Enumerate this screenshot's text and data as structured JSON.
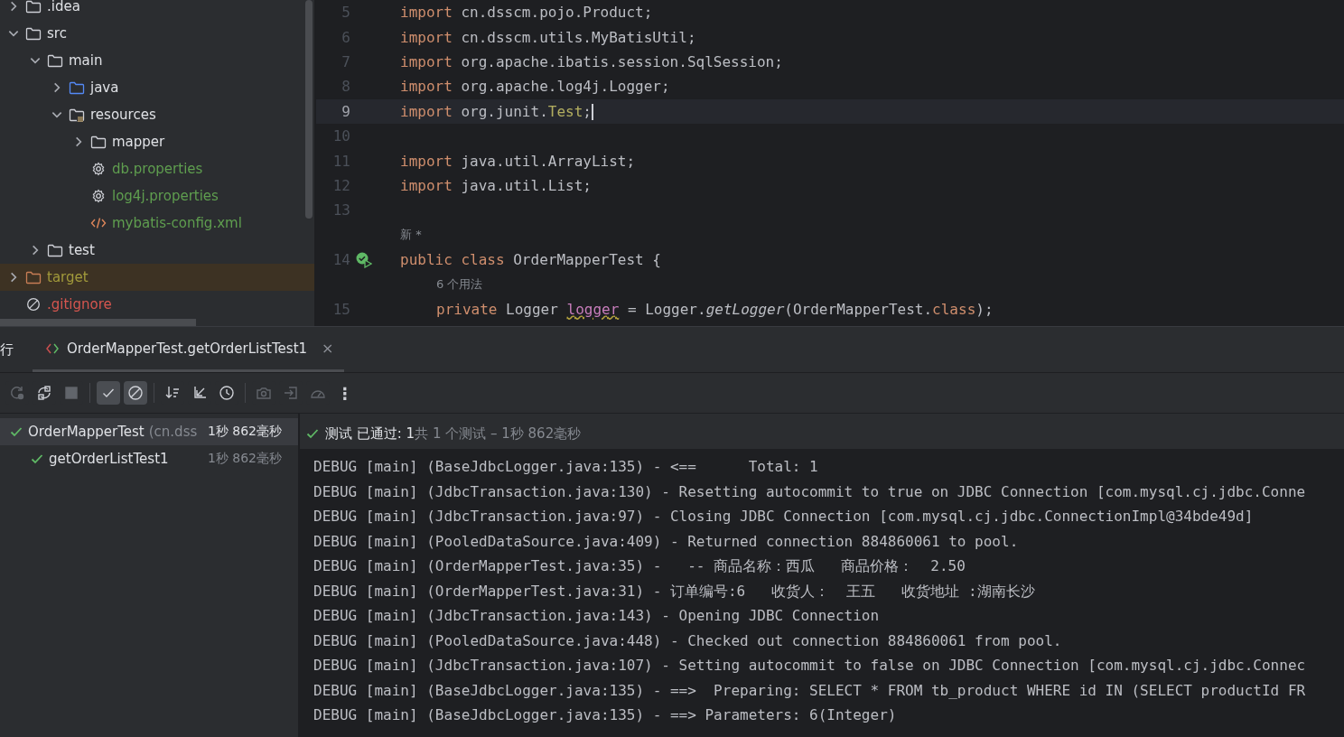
{
  "project_tree": [
    {
      "name": ".idea",
      "kind": "folder",
      "color": "#dfe1e5",
      "expanded": false
    },
    {
      "name": "src",
      "kind": "folder",
      "color": "#dfe1e5",
      "expanded": true,
      "children": [
        {
          "name": "main",
          "kind": "folder",
          "color": "#dfe1e5",
          "expanded": true,
          "children": [
            {
              "name": "java",
              "kind": "source-folder",
              "color": "#dfe1e5",
              "expanded": false
            },
            {
              "name": "resources",
              "kind": "resource-folder",
              "color": "#dfe1e5",
              "expanded": true,
              "children": [
                {
                  "name": "mapper",
                  "kind": "folder",
                  "color": "#dfe1e5",
                  "expanded": false
                },
                {
                  "name": "db.properties",
                  "kind": "properties",
                  "color": "#5f9e4f"
                },
                {
                  "name": "log4j.properties",
                  "kind": "properties",
                  "color": "#5f9e4f"
                },
                {
                  "name": "mybatis-config.xml",
                  "kind": "xml",
                  "color": "#5f9e4f"
                }
              ]
            }
          ]
        },
        {
          "name": "test",
          "kind": "folder",
          "color": "#dfe1e5",
          "expanded": false
        }
      ]
    },
    {
      "name": "target",
      "kind": "excluded-folder",
      "color": "#a29a3b",
      "expanded": false
    },
    {
      "name": ".gitignore",
      "kind": "ignore-file",
      "color": "#d6564f"
    }
  ],
  "editor": {
    "lines": [
      {
        "kind": "code",
        "number": "5",
        "current": false,
        "run_icon": false,
        "tokens": [
          {
            "kind": "keyword",
            "text": "import"
          },
          {
            "kind": "plain",
            "text": " cn.dsscm.pojo.Product;"
          }
        ]
      },
      {
        "kind": "code",
        "number": "6",
        "current": false,
        "run_icon": false,
        "tokens": [
          {
            "kind": "keyword",
            "text": "import"
          },
          {
            "kind": "plain",
            "text": " cn.dsscm.utils.MyBatisUtil;"
          }
        ]
      },
      {
        "kind": "code",
        "number": "7",
        "current": false,
        "run_icon": false,
        "tokens": [
          {
            "kind": "keyword",
            "text": "import"
          },
          {
            "kind": "plain",
            "text": " org.apache.ibatis.session.SqlSession;"
          }
        ]
      },
      {
        "kind": "code",
        "number": "8",
        "current": false,
        "run_icon": false,
        "tokens": [
          {
            "kind": "keyword",
            "text": "import"
          },
          {
            "kind": "plain",
            "text": " org.apache.log4j.Logger;"
          }
        ]
      },
      {
        "kind": "code",
        "number": "9",
        "current": true,
        "run_icon": false,
        "tokens": [
          {
            "kind": "keyword",
            "text": "import"
          },
          {
            "kind": "plain",
            "text": " org.junit."
          },
          {
            "kind": "annotation",
            "text": "Test"
          },
          {
            "kind": "plain",
            "text": ";"
          }
        ]
      },
      {
        "kind": "code",
        "number": "10",
        "current": false,
        "run_icon": false
      },
      {
        "kind": "code",
        "number": "11",
        "current": false,
        "run_icon": false,
        "tokens": [
          {
            "kind": "keyword",
            "text": "import"
          },
          {
            "kind": "plain",
            "text": " java.util.ArrayList;"
          }
        ]
      },
      {
        "kind": "code",
        "number": "12",
        "current": false,
        "run_icon": false,
        "tokens": [
          {
            "kind": "keyword",
            "text": "import"
          },
          {
            "kind": "plain",
            "text": " java.util.List;"
          }
        ]
      },
      {
        "kind": "code",
        "number": "13",
        "current": false,
        "run_icon": false
      },
      {
        "kind": "hint",
        "text": "新 *"
      },
      {
        "kind": "code",
        "number": "14",
        "current": false,
        "run_icon": true,
        "tokens": [
          {
            "kind": "keyword",
            "text": "public class"
          },
          {
            "kind": "plain",
            "text": " OrderMapperTest {"
          }
        ],
        "children": [
          {
            "kind": "hint",
            "text": "6 个用法"
          },
          {
            "kind": "code",
            "number": "15",
            "current": false,
            "run_icon": false,
            "tokens": [
              {
                "kind": "keyword",
                "text": "private"
              },
              {
                "kind": "plain",
                "text": " Logger "
              },
              {
                "kind": "field",
                "text": "logger"
              },
              {
                "kind": "plain",
                "text": " = Logger."
              },
              {
                "kind": "method",
                "text": "getLogger"
              },
              {
                "kind": "plain",
                "text": "(OrderMapperTest."
              },
              {
                "kind": "keyword",
                "text": "class"
              },
              {
                "kind": "plain",
                "text": ");"
              }
            ]
          }
        ]
      }
    ]
  },
  "run_panel": {
    "title": "行",
    "tab": {
      "label": "OrderMapperTest.getOrderListTest1",
      "close": "×"
    },
    "toolbar": [
      {
        "kind": "rerun",
        "selected": false,
        "disabled": true
      },
      {
        "kind": "rerun-failed",
        "selected": false,
        "disabled": false
      },
      {
        "kind": "stop",
        "selected": false,
        "disabled": true
      },
      {
        "kind": "sep"
      },
      {
        "kind": "show-passed",
        "selected": true,
        "disabled": false
      },
      {
        "kind": "show-ignored",
        "selected": true,
        "disabled": false
      },
      {
        "kind": "sep"
      },
      {
        "kind": "sort",
        "selected": false,
        "disabled": false
      },
      {
        "kind": "collapse",
        "selected": false,
        "disabled": false
      },
      {
        "kind": "history",
        "selected": false,
        "disabled": false
      },
      {
        "kind": "sep"
      },
      {
        "kind": "snapshot",
        "selected": false,
        "disabled": true
      },
      {
        "kind": "import",
        "selected": false,
        "disabled": true
      },
      {
        "kind": "coverage",
        "selected": false,
        "disabled": true
      },
      {
        "kind": "more",
        "text": "⋮"
      }
    ],
    "tests": [
      {
        "name": "OrderMapperTest",
        "package": "(cn.dss",
        "time": "1秒 862毫秒",
        "selected": true,
        "passed": true,
        "children": [
          {
            "name": "getOrderListTest1",
            "time": "1秒 862毫秒",
            "selected": false,
            "passed": true
          }
        ]
      }
    ],
    "status": {
      "passed": true,
      "text": "测试 已通过: 1",
      "detail": "共 1 个测试 – 1秒 862毫秒"
    },
    "console": [
      "DEBUG [main] (BaseJdbcLogger.java:135) - <==      Total: 1",
      "DEBUG [main] (JdbcTransaction.java:130) - Resetting autocommit to true on JDBC Connection [com.mysql.cj.jdbc.Conne",
      "DEBUG [main] (JdbcTransaction.java:97) - Closing JDBC Connection [com.mysql.cj.jdbc.ConnectionImpl@34bde49d]",
      "DEBUG [main] (PooledDataSource.java:409) - Returned connection 884860061 to pool.",
      "DEBUG [main] (OrderMapperTest.java:35) -   -- 商品名称：西瓜   商品价格：  2.50",
      "DEBUG [main] (OrderMapperTest.java:31) - 订单编号:6   收货人：  王五   收货地址 :湖南长沙",
      "DEBUG [main] (JdbcTransaction.java:143) - Opening JDBC Connection",
      "DEBUG [main] (PooledDataSource.java:448) - Checked out connection 884860061 from pool.",
      "DEBUG [main] (JdbcTransaction.java:107) - Setting autocommit to false on JDBC Connection [com.mysql.cj.jdbc.Connec",
      "DEBUG [main] (BaseJdbcLogger.java:135) - ==>  Preparing: SELECT * FROM tb_product WHERE id IN (SELECT productId FR",
      "DEBUG [main] (BaseJdbcLogger.java:135) - ==> Parameters: 6(Integer)"
    ]
  }
}
